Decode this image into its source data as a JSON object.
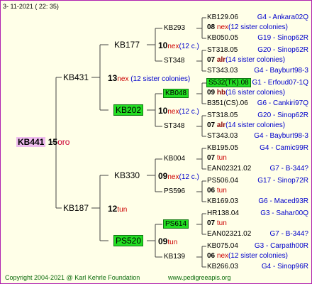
{
  "header": {
    "date": "3- 11-2021 ( 22: 35)"
  },
  "footer": {
    "copyright": "Copyright 2004-2021 @ Karl Kehrle Foundation",
    "site": "www.pedigreeapis.org"
  },
  "root": {
    "name": "KB441",
    "num": "15",
    "suffix": "oro"
  },
  "g1": [
    {
      "name": "KB431",
      "num": "13",
      "suffix": "nex",
      "extra": "(12 sister colonies)"
    },
    {
      "name": "KB187",
      "num": "12",
      "suffix": "tun",
      "extra": ""
    }
  ],
  "g2": [
    {
      "name": "KB177",
      "num": "",
      "suffix": "",
      "extra": ""
    },
    {
      "name": "KB202",
      "num": "10",
      "suffix": "nex",
      "extra": "(12 c.)"
    },
    {
      "name": "KB330",
      "num": "09",
      "suffix": "nex",
      "extra": "(12 c.)"
    },
    {
      "name": "PS520",
      "num": "09",
      "suffix": "tun",
      "extra": ""
    }
  ],
  "g3": [
    {
      "name": "KB293",
      "num": "10",
      "suffix": "nex",
      "extra": "(12 c.)"
    },
    {
      "name": "ST348",
      "num": "",
      "suffix": "",
      "extra": ""
    },
    {
      "name": "KB048",
      "num": "",
      "suffix": "",
      "extra": ""
    },
    {
      "name": "ST348",
      "num": "",
      "suffix": "",
      "extra": ""
    },
    {
      "name": "KB004",
      "num": "",
      "suffix": "",
      "extra": ""
    },
    {
      "name": "PS596",
      "num": "",
      "suffix": "",
      "extra": ""
    },
    {
      "name": "PS614",
      "num": "",
      "suffix": "",
      "extra": ""
    },
    {
      "name": "KB139",
      "num": "",
      "suffix": "",
      "extra": ""
    }
  ],
  "g4": [
    {
      "top": "KB129.06",
      "topLoc": "G4 - Ankara02Q",
      "num": "08",
      "suffix": "nex",
      "extra": "(12 sister colonies)",
      "bot": "KB050.05",
      "botLoc": "G19 - Sinop62R"
    },
    {
      "top": "ST318.05",
      "topLoc": "G20 - Sinop62R",
      "num": "07",
      "suffix": "alr",
      "extra": "(14 sister colonies)",
      "bot": "ST343.03",
      "botLoc": "G4 - Bayburt98-3"
    },
    {
      "top": "S532(TK).08",
      "topLoc": "G1 - Erfoud07-1Q",
      "num": "09",
      "suffix": "hb",
      "extra": "(16 sister colonies)",
      "bot": "B351(CS).06",
      "botLoc": "G6 - Cankiri97Q"
    },
    {
      "top": "ST318.05",
      "topLoc": "G20 - Sinop62R",
      "num": "07",
      "suffix": "alr",
      "extra": "(14 sister colonies)",
      "bot": "ST343.03",
      "botLoc": "G4 - Bayburt98-3"
    },
    {
      "top": "KB195.05",
      "topLoc": "G4 - Camic99R",
      "num": "07",
      "suffix": "tun",
      "extra": "",
      "bot": "EAN02321.02",
      "botLoc": "G7 - B-344?"
    },
    {
      "top": "PS506.04",
      "topLoc": "G17 - Sinop72R",
      "num": "06",
      "suffix": "tun",
      "extra": "",
      "bot": "KB169.03",
      "botLoc": "G6 - Maced93R"
    },
    {
      "top": "HR138.04",
      "topLoc": "G3 - Sahar00Q",
      "num": "07",
      "suffix": "tun",
      "extra": "",
      "bot": "EAN02321.02",
      "botLoc": "G7 - B-344?"
    },
    {
      "top": "KB075.04",
      "topLoc": "G3 - Carpath00R",
      "num": "06",
      "suffix": "nex",
      "extra": "(12 sister colonies)",
      "bot": "KB266.03",
      "botLoc": "G4 - Sinop96R"
    }
  ]
}
